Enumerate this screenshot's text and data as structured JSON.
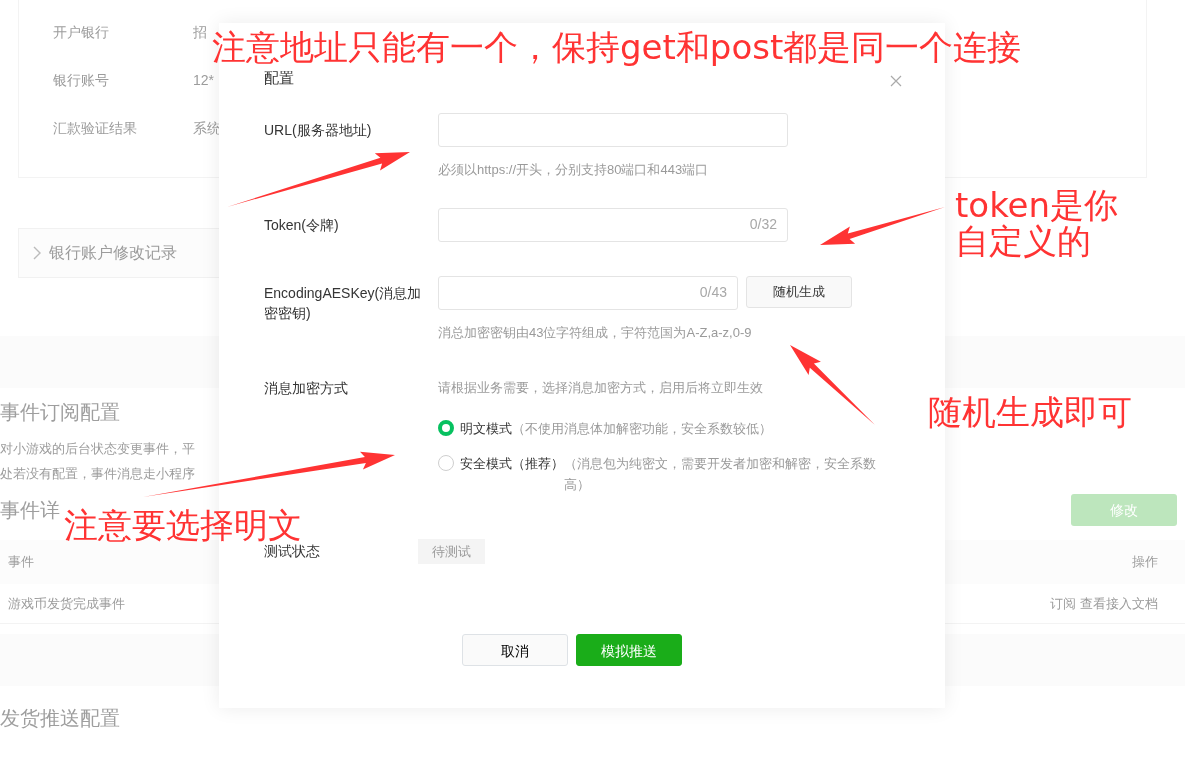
{
  "background_page": {
    "account_card": {
      "rows": [
        {
          "label": "开户银行",
          "value": "招"
        },
        {
          "label": "银行账号",
          "value": "12*"
        },
        {
          "label": "汇款验证结果",
          "value": "系统"
        }
      ]
    },
    "collapse_row": {
      "label": "银行账户修改记录"
    },
    "event_subscription": {
      "title": "事件订阅配置",
      "description": [
        "对小游戏的后台状态变更事件，平",
        "处若没有配置，事件消息走小程序"
      ]
    },
    "event_details": {
      "title": "事件详",
      "edit_button": "修改"
    },
    "table": {
      "columns": [
        "事件",
        "操作"
      ],
      "rows": [
        {
          "event": "游戏币发货完成事件",
          "actions": [
            "订阅",
            "查看接入文档"
          ]
        }
      ]
    },
    "delivery_push": {
      "title": "发货推送配置"
    }
  },
  "dialog": {
    "title": "配置",
    "fields": [
      {
        "label": "URL(服务器地址)",
        "hint": "必须以https://开头，分别支持80端口和443端口"
      },
      {
        "label": "Token(令牌)",
        "counter": "0/32"
      },
      {
        "label": "EncodingAESKey(消息加密密钥)",
        "counter": "0/43",
        "button": "随机生成",
        "hint": "消总加密密钥由43位字符组成，宇符范国为A-Z,a-z,0-9"
      }
    ],
    "encryption": {
      "label": "消息加密方式",
      "hint": "请根据业务需要，选择消息加密方式，启用后将立即生效",
      "options": [
        {
          "label": "明文模式",
          "note": "（不使用消息体加解密功能，安全系数较低）",
          "selected": true
        },
        {
          "label": "安全模式（推荐）",
          "note": "（消息包为纯密文，需要开发者加密和解密，安全系数高）",
          "selected": false
        }
      ]
    },
    "test_status": {
      "label": "测试状态",
      "value": "待测试"
    },
    "buttons": [
      {
        "label": "取消",
        "kind": "secondary"
      },
      {
        "label": "模拟推送",
        "kind": "primary"
      }
    ]
  },
  "annotations": [
    {
      "text": "注意地址只能有一个，保持get和post都是同一个连接"
    },
    {
      "text": "token是你自定义的"
    },
    {
      "text": "随机生成即可"
    },
    {
      "text": "注意要选择明文"
    }
  ]
}
